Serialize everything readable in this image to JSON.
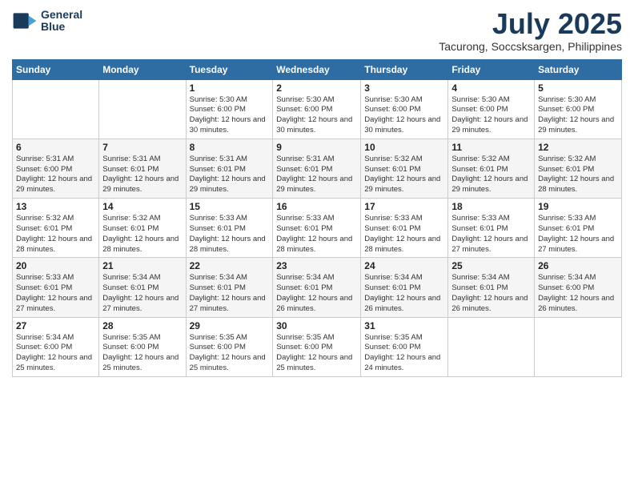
{
  "header": {
    "logo_line1": "General",
    "logo_line2": "Blue",
    "month": "July 2025",
    "location": "Tacurong, Soccsksargen, Philippines"
  },
  "days_of_week": [
    "Sunday",
    "Monday",
    "Tuesday",
    "Wednesday",
    "Thursday",
    "Friday",
    "Saturday"
  ],
  "weeks": [
    [
      {
        "day": "",
        "sunrise": "",
        "sunset": "",
        "daylight": ""
      },
      {
        "day": "",
        "sunrise": "",
        "sunset": "",
        "daylight": ""
      },
      {
        "day": "1",
        "sunrise": "Sunrise: 5:30 AM",
        "sunset": "Sunset: 6:00 PM",
        "daylight": "Daylight: 12 hours and 30 minutes."
      },
      {
        "day": "2",
        "sunrise": "Sunrise: 5:30 AM",
        "sunset": "Sunset: 6:00 PM",
        "daylight": "Daylight: 12 hours and 30 minutes."
      },
      {
        "day": "3",
        "sunrise": "Sunrise: 5:30 AM",
        "sunset": "Sunset: 6:00 PM",
        "daylight": "Daylight: 12 hours and 30 minutes."
      },
      {
        "day": "4",
        "sunrise": "Sunrise: 5:30 AM",
        "sunset": "Sunset: 6:00 PM",
        "daylight": "Daylight: 12 hours and 29 minutes."
      },
      {
        "day": "5",
        "sunrise": "Sunrise: 5:30 AM",
        "sunset": "Sunset: 6:00 PM",
        "daylight": "Daylight: 12 hours and 29 minutes."
      }
    ],
    [
      {
        "day": "6",
        "sunrise": "Sunrise: 5:31 AM",
        "sunset": "Sunset: 6:00 PM",
        "daylight": "Daylight: 12 hours and 29 minutes."
      },
      {
        "day": "7",
        "sunrise": "Sunrise: 5:31 AM",
        "sunset": "Sunset: 6:01 PM",
        "daylight": "Daylight: 12 hours and 29 minutes."
      },
      {
        "day": "8",
        "sunrise": "Sunrise: 5:31 AM",
        "sunset": "Sunset: 6:01 PM",
        "daylight": "Daylight: 12 hours and 29 minutes."
      },
      {
        "day": "9",
        "sunrise": "Sunrise: 5:31 AM",
        "sunset": "Sunset: 6:01 PM",
        "daylight": "Daylight: 12 hours and 29 minutes."
      },
      {
        "day": "10",
        "sunrise": "Sunrise: 5:32 AM",
        "sunset": "Sunset: 6:01 PM",
        "daylight": "Daylight: 12 hours and 29 minutes."
      },
      {
        "day": "11",
        "sunrise": "Sunrise: 5:32 AM",
        "sunset": "Sunset: 6:01 PM",
        "daylight": "Daylight: 12 hours and 29 minutes."
      },
      {
        "day": "12",
        "sunrise": "Sunrise: 5:32 AM",
        "sunset": "Sunset: 6:01 PM",
        "daylight": "Daylight: 12 hours and 28 minutes."
      }
    ],
    [
      {
        "day": "13",
        "sunrise": "Sunrise: 5:32 AM",
        "sunset": "Sunset: 6:01 PM",
        "daylight": "Daylight: 12 hours and 28 minutes."
      },
      {
        "day": "14",
        "sunrise": "Sunrise: 5:32 AM",
        "sunset": "Sunset: 6:01 PM",
        "daylight": "Daylight: 12 hours and 28 minutes."
      },
      {
        "day": "15",
        "sunrise": "Sunrise: 5:33 AM",
        "sunset": "Sunset: 6:01 PM",
        "daylight": "Daylight: 12 hours and 28 minutes."
      },
      {
        "day": "16",
        "sunrise": "Sunrise: 5:33 AM",
        "sunset": "Sunset: 6:01 PM",
        "daylight": "Daylight: 12 hours and 28 minutes."
      },
      {
        "day": "17",
        "sunrise": "Sunrise: 5:33 AM",
        "sunset": "Sunset: 6:01 PM",
        "daylight": "Daylight: 12 hours and 28 minutes."
      },
      {
        "day": "18",
        "sunrise": "Sunrise: 5:33 AM",
        "sunset": "Sunset: 6:01 PM",
        "daylight": "Daylight: 12 hours and 27 minutes."
      },
      {
        "day": "19",
        "sunrise": "Sunrise: 5:33 AM",
        "sunset": "Sunset: 6:01 PM",
        "daylight": "Daylight: 12 hours and 27 minutes."
      }
    ],
    [
      {
        "day": "20",
        "sunrise": "Sunrise: 5:33 AM",
        "sunset": "Sunset: 6:01 PM",
        "daylight": "Daylight: 12 hours and 27 minutes."
      },
      {
        "day": "21",
        "sunrise": "Sunrise: 5:34 AM",
        "sunset": "Sunset: 6:01 PM",
        "daylight": "Daylight: 12 hours and 27 minutes."
      },
      {
        "day": "22",
        "sunrise": "Sunrise: 5:34 AM",
        "sunset": "Sunset: 6:01 PM",
        "daylight": "Daylight: 12 hours and 27 minutes."
      },
      {
        "day": "23",
        "sunrise": "Sunrise: 5:34 AM",
        "sunset": "Sunset: 6:01 PM",
        "daylight": "Daylight: 12 hours and 26 minutes."
      },
      {
        "day": "24",
        "sunrise": "Sunrise: 5:34 AM",
        "sunset": "Sunset: 6:01 PM",
        "daylight": "Daylight: 12 hours and 26 minutes."
      },
      {
        "day": "25",
        "sunrise": "Sunrise: 5:34 AM",
        "sunset": "Sunset: 6:01 PM",
        "daylight": "Daylight: 12 hours and 26 minutes."
      },
      {
        "day": "26",
        "sunrise": "Sunrise: 5:34 AM",
        "sunset": "Sunset: 6:00 PM",
        "daylight": "Daylight: 12 hours and 26 minutes."
      }
    ],
    [
      {
        "day": "27",
        "sunrise": "Sunrise: 5:34 AM",
        "sunset": "Sunset: 6:00 PM",
        "daylight": "Daylight: 12 hours and 25 minutes."
      },
      {
        "day": "28",
        "sunrise": "Sunrise: 5:35 AM",
        "sunset": "Sunset: 6:00 PM",
        "daylight": "Daylight: 12 hours and 25 minutes."
      },
      {
        "day": "29",
        "sunrise": "Sunrise: 5:35 AM",
        "sunset": "Sunset: 6:00 PM",
        "daylight": "Daylight: 12 hours and 25 minutes."
      },
      {
        "day": "30",
        "sunrise": "Sunrise: 5:35 AM",
        "sunset": "Sunset: 6:00 PM",
        "daylight": "Daylight: 12 hours and 25 minutes."
      },
      {
        "day": "31",
        "sunrise": "Sunrise: 5:35 AM",
        "sunset": "Sunset: 6:00 PM",
        "daylight": "Daylight: 12 hours and 24 minutes."
      },
      {
        "day": "",
        "sunrise": "",
        "sunset": "",
        "daylight": ""
      },
      {
        "day": "",
        "sunrise": "",
        "sunset": "",
        "daylight": ""
      }
    ]
  ]
}
